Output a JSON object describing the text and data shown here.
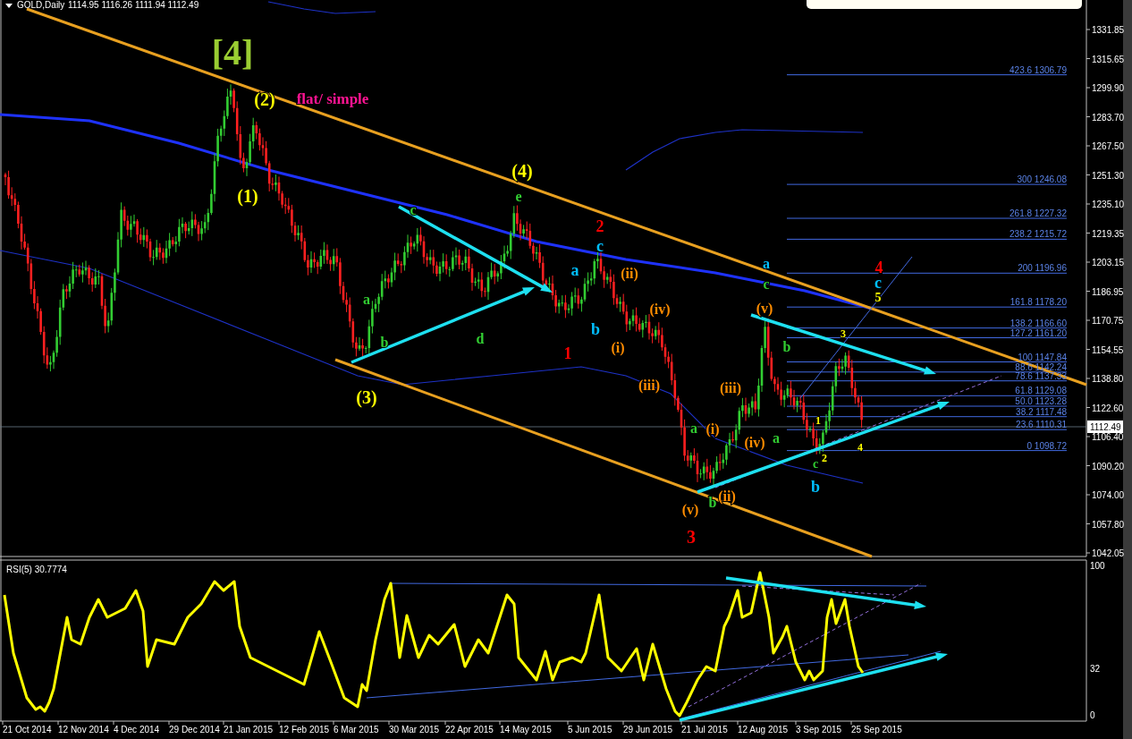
{
  "chart": {
    "symbol": "GOLD,Daily",
    "quote": "1114.95 1116.26 1111.94 1112.49"
  },
  "price_axis": [
    "1331.85",
    "1315.65",
    "1299.90",
    "1283.70",
    "1267.50",
    "1251.30",
    "1235.10",
    "1219.35",
    "1203.15",
    "1186.95",
    "1170.75",
    "1154.55",
    "1138.80",
    "1122.60",
    "1106.40",
    "1090.20",
    "1074.00",
    "1057.80",
    "1042.05"
  ],
  "current_price": "1112.49",
  "fib_levels": [
    "423.6 1306.79",
    "300 1246.08",
    "261.8 1227.32",
    "238.2 1215.72",
    "200 1196.96",
    "161.8 1178.20",
    "138.2 1166.60",
    "127.2 1161.20",
    "100 1147.84",
    "88.6 1142.24",
    "78.6 1137.33",
    "61.8 1129.08",
    "50.0 1123.28",
    "38.2 1117.48",
    "23.6 1110.31",
    "0 1098.72"
  ],
  "waves": [
    {
      "text": "[4]",
      "color": "#9acd32"
    },
    {
      "text": "(2)",
      "color": "#ffff00"
    },
    {
      "text": "flat/ simple",
      "color": "#ff1493"
    },
    {
      "text": "(1)",
      "color": "#ffff00"
    },
    {
      "text": "(4)",
      "color": "#ffff00"
    },
    {
      "text": "e",
      "color": "#32cd32"
    },
    {
      "text": "c",
      "color": "#32cd32"
    },
    {
      "text": "a",
      "color": "#32cd32"
    },
    {
      "text": "b",
      "color": "#32cd32"
    },
    {
      "text": "d",
      "color": "#32cd32"
    },
    {
      "text": "(3)",
      "color": "#ffff00"
    },
    {
      "text": "2",
      "color": "#ff0000"
    },
    {
      "text": "c",
      "color": "#00bfff"
    },
    {
      "text": "a",
      "color": "#00bfff"
    },
    {
      "text": "b",
      "color": "#00bfff"
    },
    {
      "text": "1",
      "color": "#ff0000"
    },
    {
      "text": "(ii)",
      "color": "#ff8c00"
    },
    {
      "text": "(iv)",
      "color": "#ff8c00"
    },
    {
      "text": "(i)",
      "color": "#ff8c00"
    },
    {
      "text": "(iii)",
      "color": "#ff8c00"
    },
    {
      "text": "a",
      "color": "#32cd32"
    },
    {
      "text": "(i)",
      "color": "#ff8c00"
    },
    {
      "text": "(iii)",
      "color": "#ff8c00"
    },
    {
      "text": "(iv)",
      "color": "#ff8c00"
    },
    {
      "text": "a",
      "color": "#32cd32"
    },
    {
      "text": "(v)",
      "color": "#ff8c00"
    },
    {
      "text": "b",
      "color": "#32cd32"
    },
    {
      "text": "(ii)",
      "color": "#ff8c00"
    },
    {
      "text": "3",
      "color": "#ff0000"
    },
    {
      "text": "(v)",
      "color": "#ff8c00"
    },
    {
      "text": "b",
      "color": "#32cd32"
    },
    {
      "text": "a",
      "color": "#00bfff"
    },
    {
      "text": "c",
      "color": "#32cd32"
    },
    {
      "text": "1",
      "color": "#ffff00"
    },
    {
      "text": "2",
      "color": "#ffff00"
    },
    {
      "text": "c",
      "color": "#32cd32"
    },
    {
      "text": "b",
      "color": "#00bfff"
    },
    {
      "text": "3",
      "color": "#ffff00"
    },
    {
      "text": "4",
      "color": "#ffff00"
    },
    {
      "text": "4",
      "color": "#ff0000"
    },
    {
      "text": "c",
      "color": "#00bfff"
    },
    {
      "text": "5",
      "color": "#ffff00"
    }
  ],
  "rsi": {
    "label": "RSI(5) 30.7774",
    "axis": [
      "100",
      "32",
      "0"
    ]
  },
  "dates": [
    "21 Oct 2014",
    "12 Nov 2014",
    "4 Dec 2014",
    "29 Dec 2014",
    "21 Jan 2015",
    "12 Feb 2015",
    "6 Mar 2015",
    "30 Mar 2015",
    "22 Apr 2015",
    "14 May 2015",
    "5 Jun 2015",
    "29 Jun 2015",
    "21 Jul 2015",
    "12 Aug 2015",
    "3 Sep 2015",
    "25 Sep 2015"
  ]
}
